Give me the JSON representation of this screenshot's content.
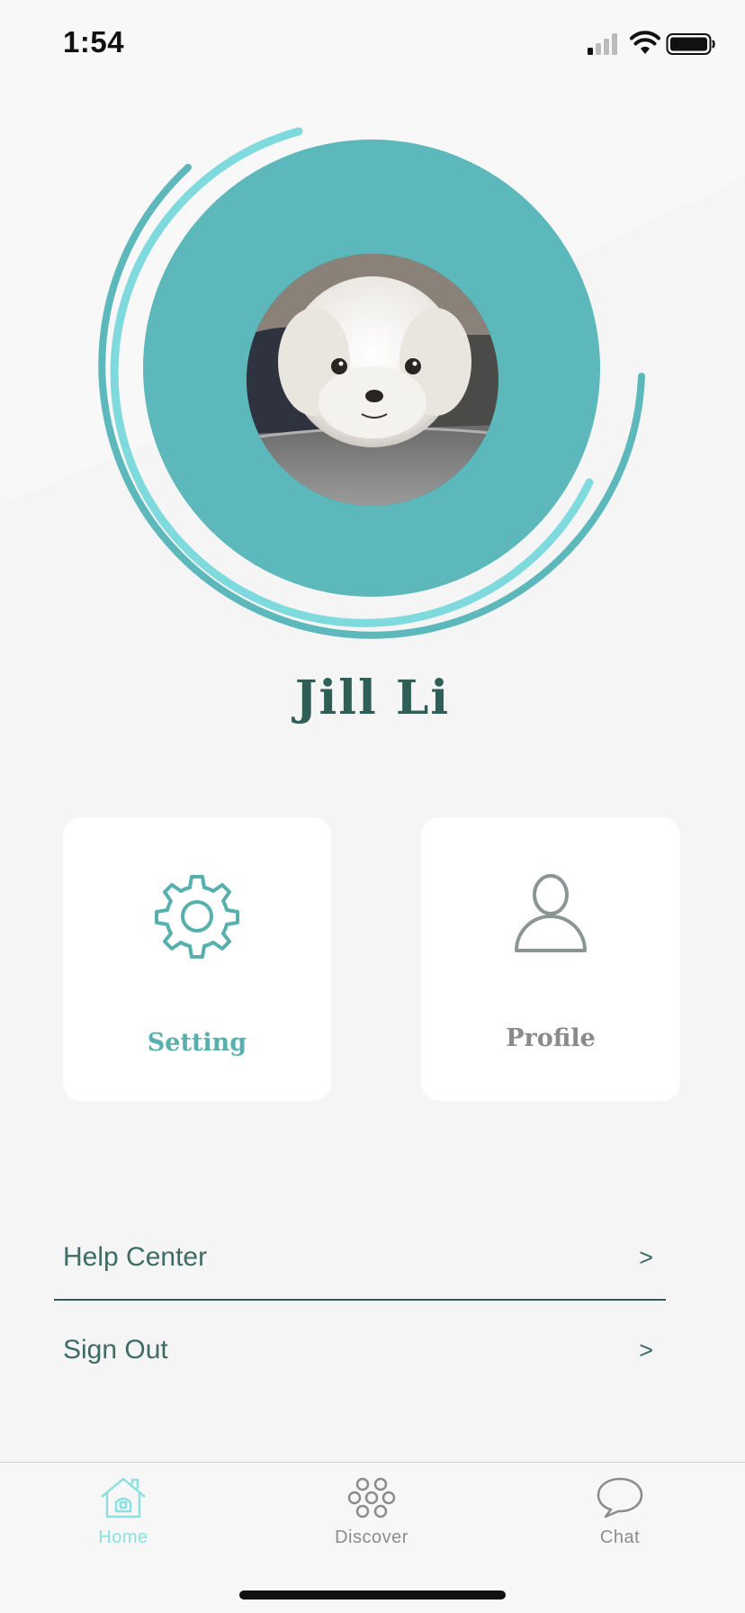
{
  "status_bar": {
    "time": "1:54"
  },
  "user": {
    "name": "Jill Li",
    "avatar_description_icon": "dog-photo"
  },
  "cards": [
    {
      "label": "Setting",
      "icon": "gear-icon"
    },
    {
      "label": "Profile",
      "icon": "person-icon"
    }
  ],
  "list": [
    {
      "label": "Help Center",
      "chevron": ">"
    },
    {
      "label": "Sign Out",
      "chevron": ">"
    }
  ],
  "tabs": [
    {
      "label": "Home",
      "icon": "home-icon",
      "active": true
    },
    {
      "label": "Discover",
      "icon": "discover-icon",
      "active": false
    },
    {
      "label": "Chat",
      "icon": "chat-icon",
      "active": false
    }
  ],
  "colors": {
    "background": "#f5f5f5",
    "ring": "#5cb8ba",
    "ring_light": "#7fdadd",
    "name_text": "#2f5e57",
    "setting_accent": "#58b0ae",
    "tab_active": "#8ee0e0",
    "tab_inactive": "#8c8c8c"
  }
}
